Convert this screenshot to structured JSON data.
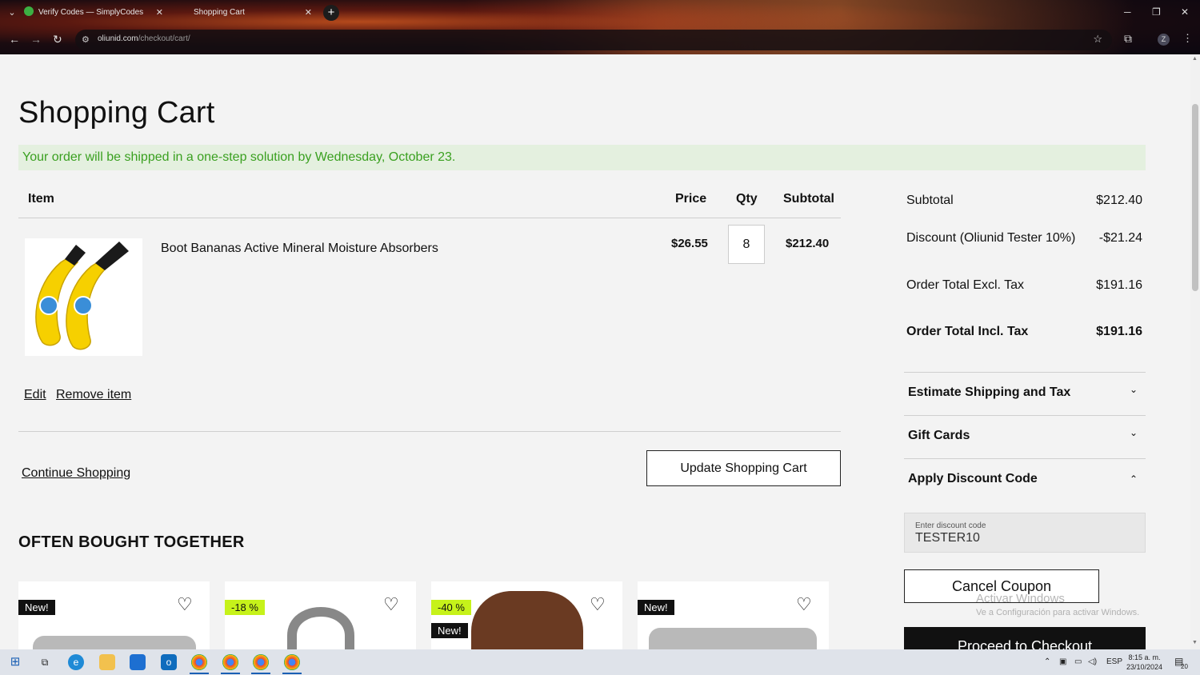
{
  "browser": {
    "tabs": [
      {
        "title": "Verify Codes — SimplyCodes",
        "close": "✕"
      },
      {
        "title": "Shopping Cart",
        "close": "✕"
      }
    ],
    "url_host": "oliunid.com",
    "url_path": "/checkout/cart/",
    "new_tab": "+",
    "profile_initial": "Z"
  },
  "cart": {
    "title": "Shopping Cart",
    "shipping_notice": "Your order will be shipped in a one-step solution by Wednesday, October 23.",
    "columns": {
      "item": "Item",
      "price": "Price",
      "qty": "Qty",
      "subtotal": "Subtotal"
    },
    "item": {
      "name": "Boot Bananas Active Mineral Moisture Absorbers",
      "price": "$26.55",
      "qty": "8",
      "subtotal": "$212.40",
      "edit_label": "Edit",
      "remove_label": "Remove item"
    },
    "continue_label": "Continue Shopping",
    "update_label": "Update Shopping Cart"
  },
  "often_bought": {
    "title": "OFTEN BOUGHT TOGETHER",
    "cards": [
      {
        "badge": "New!"
      },
      {
        "badge": "-18 %"
      },
      {
        "badge": "-40 %",
        "badge2": "New!"
      },
      {
        "badge": "New!"
      }
    ]
  },
  "summary": {
    "subtotal_label": "Subtotal",
    "subtotal": "$212.40",
    "discount_label": "Discount (Oliunid Tester 10%)",
    "discount": "-$21.24",
    "excl_label": "Order Total Excl. Tax",
    "excl": "$191.16",
    "incl_label": "Order Total Incl. Tax",
    "incl": "$191.16",
    "estimate_label": "Estimate Shipping and Tax",
    "gift_label": "Gift Cards",
    "discount_code_label": "Apply Discount Code",
    "discount_field_label": "Enter discount code",
    "discount_code_value": "TESTER10",
    "cancel_coupon_label": "Cancel Coupon",
    "checkout_label": "Proceed to Checkout"
  },
  "windows": {
    "watermark_title": "Activar Windows",
    "watermark_sub": "Ve a Configuración para activar Windows.",
    "lang": "ESP",
    "time": "8:15 a. m.",
    "date": "23/10/2024",
    "notifications": "20"
  },
  "colors": {
    "notice_text": "#3aa020",
    "notice_bg": "#e4f0df",
    "sale_badge": "#c6f21a"
  }
}
